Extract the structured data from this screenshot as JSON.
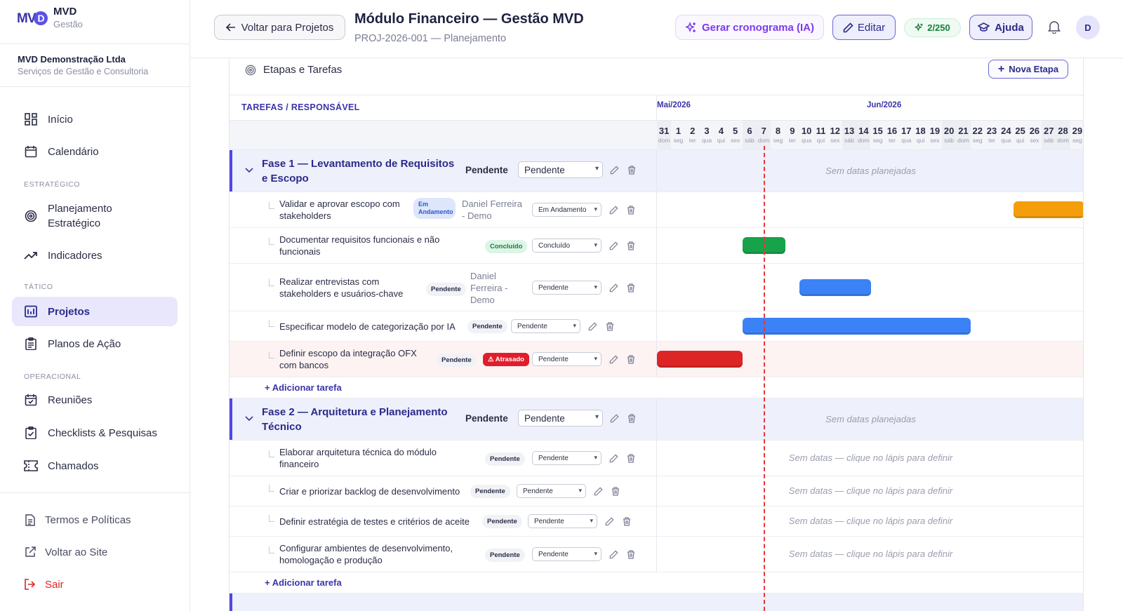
{
  "brand": {
    "name": "MVD",
    "subtitle": "Gestão",
    "logo_text": "MV",
    "logo_d": "D"
  },
  "org": {
    "name": "MVD Demonstração Ltda",
    "desc": "Serviços de Gestão e Consultoria"
  },
  "nav": {
    "inicio": "Início",
    "calendario": "Calendário",
    "sec_estrategico": "ESTRATÉGICO",
    "planejamento": "Planejamento Estratégico",
    "indicadores": "Indicadores",
    "sec_tatico": "TÁTICO",
    "projetos": "Projetos",
    "planos": "Planos de Ação",
    "sec_operacional": "OPERACIONAL",
    "reunioes": "Reuniões",
    "checklists": "Checklists & Pesquisas",
    "chamados": "Chamados"
  },
  "footer": {
    "termos": "Termos e Políticas",
    "voltar_site": "Voltar ao Site",
    "sair": "Sair"
  },
  "header": {
    "back": "Voltar para Projetos",
    "title": "Módulo Financeiro — Gestão MVD",
    "subtitle": "PROJ-2026-001 — Planejamento",
    "generate": "Gerar cronograma (IA)",
    "edit": "Editar",
    "quota": "2/250",
    "help": "Ajuda",
    "avatar": "D"
  },
  "section": {
    "title": "Etapas e Tarefas",
    "new_stage": "Nova Etapa"
  },
  "gantt": {
    "col_header": "TAREFAS / RESPONSÁVEL",
    "month1": "Mai/2026",
    "month2": "Jun/2026",
    "days": [
      {
        "n": "31",
        "w": "dom"
      },
      {
        "n": "1",
        "w": "seg"
      },
      {
        "n": "2",
        "w": "ter"
      },
      {
        "n": "3",
        "w": "qua"
      },
      {
        "n": "4",
        "w": "qui"
      },
      {
        "n": "5",
        "w": "sex"
      },
      {
        "n": "6",
        "w": "sáb"
      },
      {
        "n": "7",
        "w": "dom"
      },
      {
        "n": "8",
        "w": "seg"
      },
      {
        "n": "9",
        "w": "ter"
      },
      {
        "n": "10",
        "w": "qua"
      },
      {
        "n": "11",
        "w": "qui"
      },
      {
        "n": "12",
        "w": "sex"
      },
      {
        "n": "13",
        "w": "sáb"
      },
      {
        "n": "14",
        "w": "dom"
      },
      {
        "n": "15",
        "w": "seg"
      },
      {
        "n": "16",
        "w": "ter"
      },
      {
        "n": "17",
        "w": "qua"
      },
      {
        "n": "18",
        "w": "qui"
      },
      {
        "n": "19",
        "w": "sex"
      },
      {
        "n": "20",
        "w": "sáb"
      },
      {
        "n": "21",
        "w": "dom"
      },
      {
        "n": "22",
        "w": "seg"
      },
      {
        "n": "23",
        "w": "ter"
      },
      {
        "n": "24",
        "w": "qua"
      },
      {
        "n": "25",
        "w": "qui"
      },
      {
        "n": "26",
        "w": "sex"
      },
      {
        "n": "27",
        "w": "sáb"
      },
      {
        "n": "28",
        "w": "dom"
      },
      {
        "n": "29",
        "w": "seg"
      }
    ],
    "no_dates_phase": "Sem datas planejadas",
    "no_dates_task": "Sem datas — clique no lápis para definir",
    "add_task": "+ Adicionar tarefa",
    "phases": [
      {
        "title": "Fase 1 — Levantamento de Requisitos e Escopo",
        "status": "Pendente",
        "select": "Pendente"
      },
      {
        "title": "Fase 2 — Arquitetura e Planejamento Técnico",
        "status": "Pendente",
        "select": "Pendente"
      }
    ],
    "tasks1": [
      {
        "title": "Validar e aprovar escopo com stakeholders",
        "badge": "Em Andamento",
        "resp": "Daniel Ferreira - Demo",
        "select": "Em Andamento"
      },
      {
        "title": "Documentar requisitos funcionais e não funcionais",
        "badge": "Concluído",
        "select": "Concluído"
      },
      {
        "title": "Realizar entrevistas com stakeholders e usuários-chave",
        "badge": "Pendente",
        "resp": "Daniel Ferreira - Demo",
        "select": "Pendente"
      },
      {
        "title": "Especificar modelo de categorização por IA",
        "badge": "Pendente",
        "select": "Pendente"
      },
      {
        "title": "Definir escopo da integração OFX com bancos",
        "badge": "Pendente",
        "late": "⚠ Atrasado",
        "select": "Pendente"
      }
    ],
    "tasks2": [
      {
        "title": "Elaborar arquitetura técnica do módulo financeiro",
        "badge": "Pendente",
        "select": "Pendente"
      },
      {
        "title": "Criar e priorizar backlog de desenvolvimento",
        "badge": "Pendente",
        "select": "Pendente"
      },
      {
        "title": "Definir estratégia de testes e critérios de aceite",
        "badge": "Pendente",
        "select": "Pendente"
      },
      {
        "title": "Configurar ambientes de desenvolvimento, homologação e produção",
        "badge": "Pendente",
        "select": "Pendente"
      }
    ],
    "bars": [
      {
        "task": 0,
        "start_day": "25/06",
        "end_day": "29/06",
        "color": "#f59e0b"
      },
      {
        "task": 1,
        "start_day": "06/06",
        "end_day": "08/06",
        "color": "#16a34a"
      },
      {
        "task": 2,
        "start_day": "10/06",
        "end_day": "14/06",
        "color": "#3b82f6"
      },
      {
        "task": 3,
        "start_day": "06/06",
        "end_day": "21/06",
        "color": "#3b82f6"
      },
      {
        "task": 4,
        "start_day": "31/05",
        "end_day": "05/06",
        "color": "#dc2626"
      }
    ],
    "today": "07/06"
  },
  "colors": {
    "accent": "#4f46e5",
    "danger": "#dc2626"
  }
}
